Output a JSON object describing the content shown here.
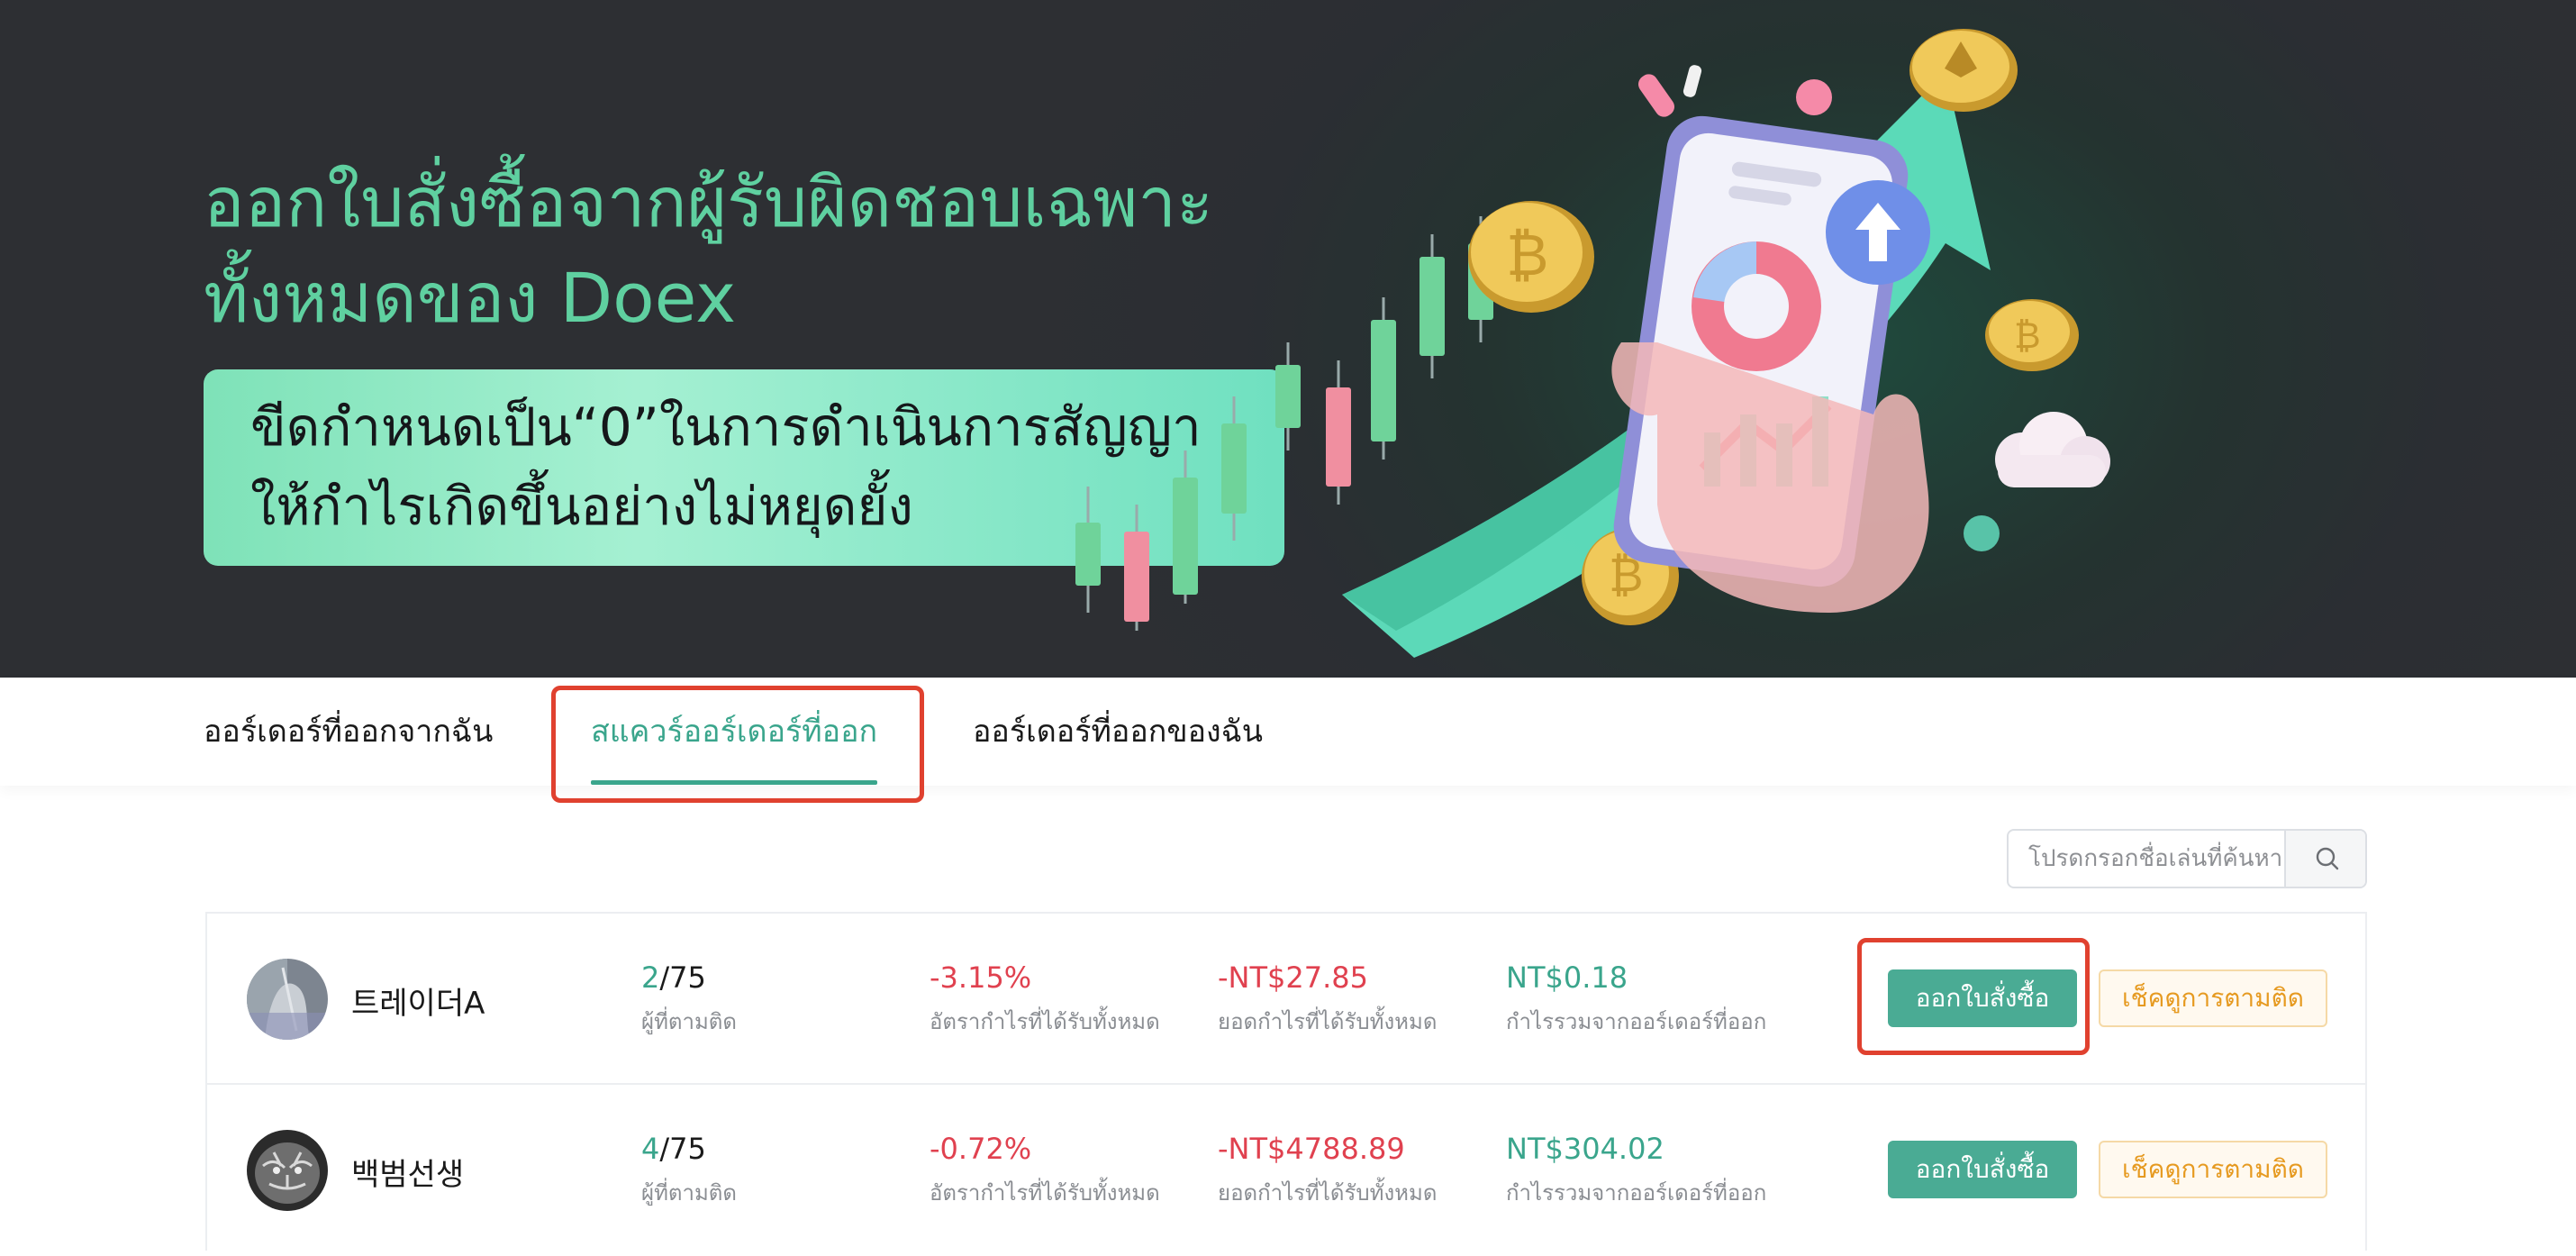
{
  "banner": {
    "title_line1": "ออกใบสั่งซื้อจากผู้รับผิดชอบเฉพาะ",
    "title_line2": "ทั้งหมดของ Doex",
    "promo_line1": "ขีดกำหนดเป็น“0”ในการดำเนินการสัญญา",
    "promo_line2": "ให้กำไรเกิดขึ้นอย่างไม่หยุดยั้ง"
  },
  "tabs": [
    {
      "label": "ออร์เดอร์ที่ออกจากฉัน",
      "active": false
    },
    {
      "label": "สแควร์ออร์เดอร์ที่ออก",
      "active": true
    },
    {
      "label": "ออร์เดอร์ที่ออกของฉัน",
      "active": false
    }
  ],
  "search": {
    "placeholder": "โปรดกรอกชื่อเล่นที่ค้นหา"
  },
  "traders": [
    {
      "name": "트레이더A",
      "followers_current": "2",
      "followers_max": "/75",
      "followers_label": "ผู้ที่ตามติด",
      "return_rate": "-3.15%",
      "return_rate_label": "อัตรากำไรที่ได้รับทั้งหมด",
      "total_profit": "-NT$27.85",
      "total_profit_label": "ยอดกำไรที่ได้รับทั้งหมด",
      "order_profit": "NT$0.18",
      "order_profit_label": "กำไรรวมจากออร์เดอร์ที่ออก",
      "order_button": "ออกใบสั่งซื้อ",
      "check_button": "เช็คดูการตามติด"
    },
    {
      "name": "백범선생",
      "followers_current": "4",
      "followers_max": "/75",
      "followers_label": "ผู้ที่ตามติด",
      "return_rate": "-0.72%",
      "return_rate_label": "อัตรากำไรที่ได้รับทั้งหมด",
      "total_profit": "-NT$4788.89",
      "total_profit_label": "ยอดกำไรที่ได้รับทั้งหมด",
      "order_profit": "NT$304.02",
      "order_profit_label": "กำไรรวมจากออร์เดอร์ที่ออก",
      "order_button": "ออกใบสั่งซื้อ",
      "check_button": "เช็คดูการตามติด"
    }
  ],
  "colors": {
    "accent": "#3aa58c",
    "negative": "#e0414f",
    "highlight_outline": "#e0412f",
    "check_button_text": "#e69a20"
  }
}
